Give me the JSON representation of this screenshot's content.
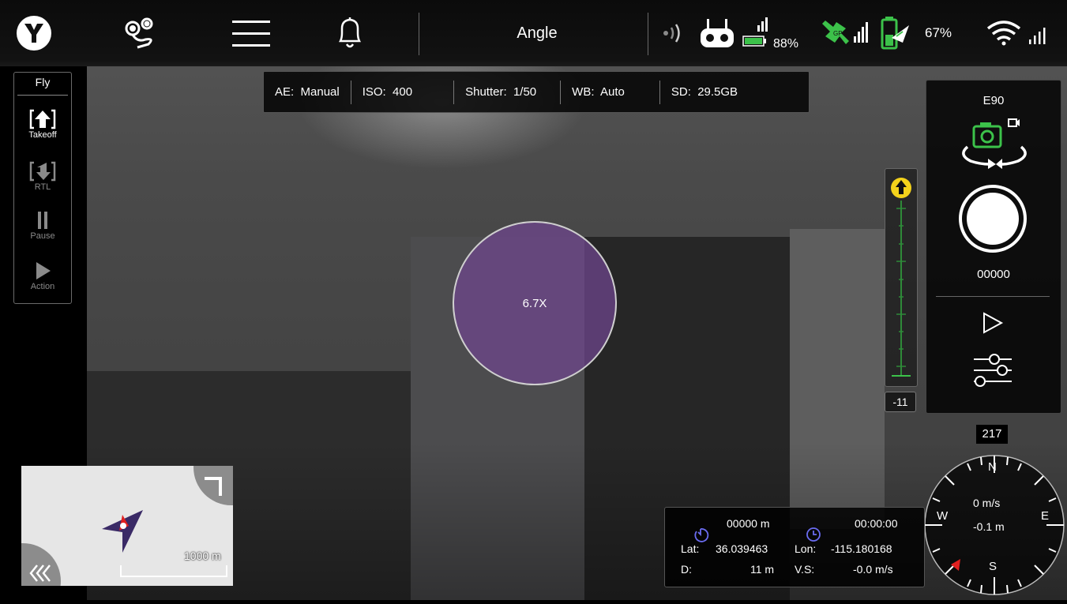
{
  "topbar": {
    "title": "Angle",
    "controller_battery": "88%",
    "drone_battery": "67%",
    "icons": [
      "app-logo-icon",
      "route-planning-icon",
      "menu-icon",
      "bell-icon",
      "signal-broadcast-icon",
      "remote-controller-icon",
      "gps-satellite-icon",
      "battery-icon",
      "wifi-icon"
    ]
  },
  "fly_panel": {
    "header": "Fly",
    "buttons": [
      {
        "label": "Takeoff",
        "enabled": true
      },
      {
        "label": "RTL",
        "enabled": false
      },
      {
        "label": "Pause",
        "enabled": false
      },
      {
        "label": "Action",
        "enabled": false
      }
    ]
  },
  "camera_settings": {
    "ae": "AE:  Manual",
    "iso": "ISO:  400",
    "shutter": "Shutter:  1/50",
    "wb": "WB:  Auto",
    "sd": "SD:  29.5GB"
  },
  "zoom": {
    "label": "6.7X"
  },
  "gimbal": {
    "value": "-11"
  },
  "camera_panel": {
    "model": "E90",
    "counter": "00000",
    "accent_color": "#3cc24a"
  },
  "compass": {
    "heading": "217",
    "n": "N",
    "s": "S",
    "e": "E",
    "w": "W",
    "speed": "0 m/s",
    "altitude": "-0.1 m"
  },
  "telemetry": {
    "distance": "00000 m",
    "time": "00:00:00",
    "lat_label": "Lat:",
    "lat": "36.039463",
    "lon_label": "Lon:",
    "lon": "-115.180168",
    "d_label": "D:",
    "d": "11 m",
    "vs_label": "V.S:",
    "vs": "-0.0 m/s"
  },
  "map": {
    "scale": "1000 m"
  }
}
